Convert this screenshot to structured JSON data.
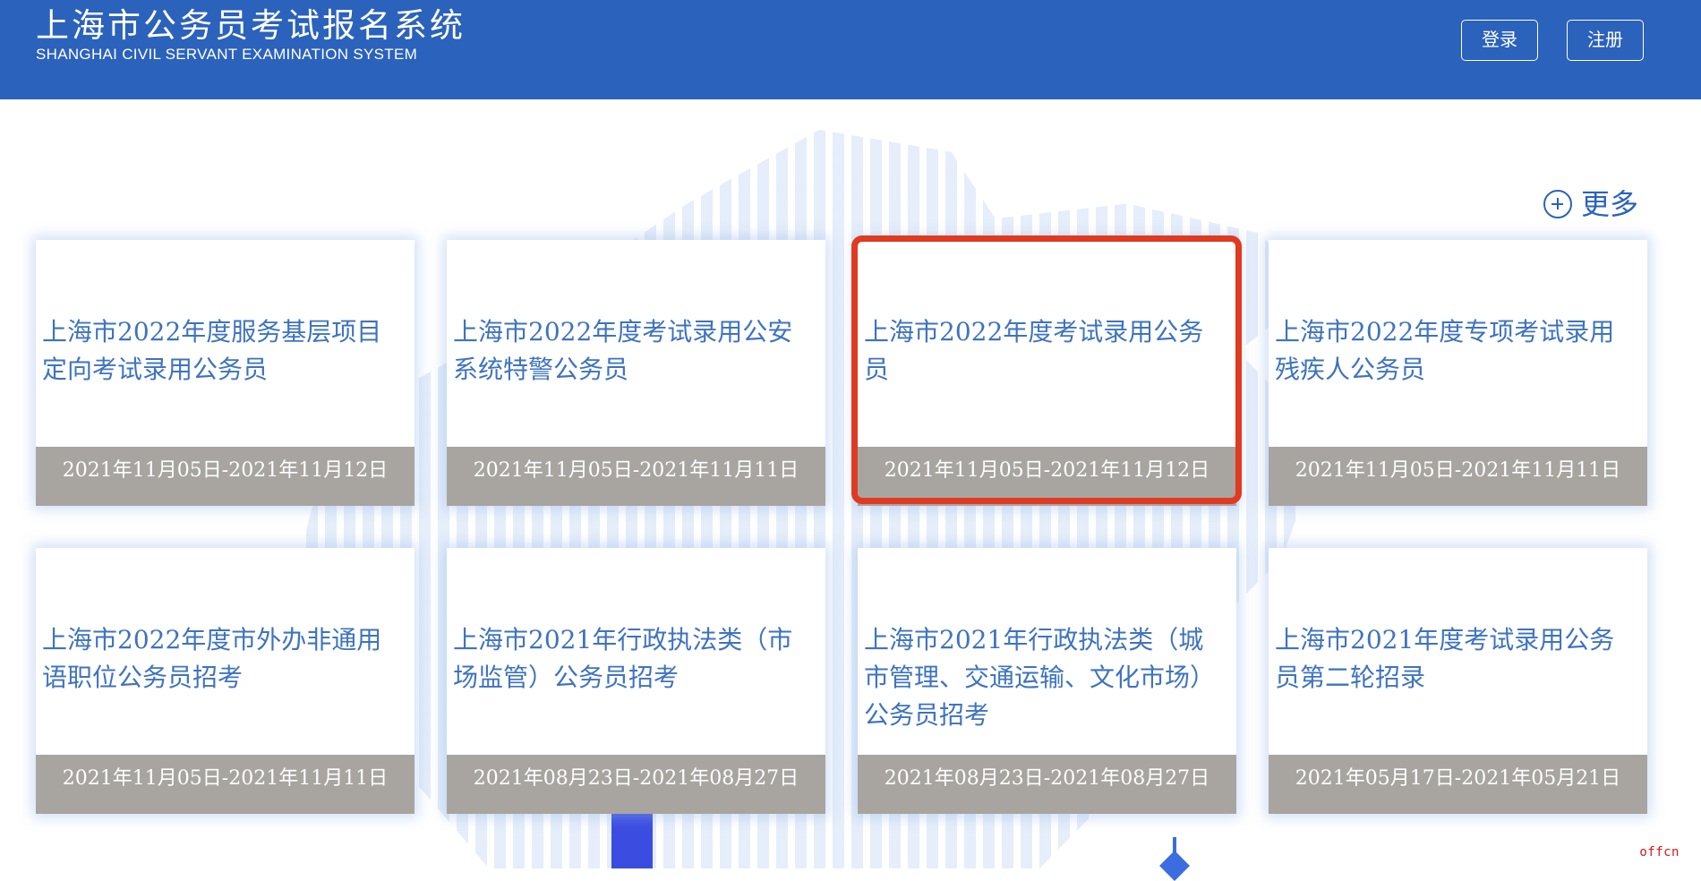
{
  "header": {
    "title": "上海市公务员考试报名系统",
    "subtitle": "SHANGHAI CIVIL SERVANT EXAMINATION SYSTEM",
    "login_label": "登录",
    "register_label": "注册"
  },
  "more": {
    "label": "更多",
    "icon": "plus-circle-icon"
  },
  "cards": [
    {
      "title": "上海市2022年度服务基层项目定向考试录用公务员",
      "date": "2021年11月05日-2021年11月12日"
    },
    {
      "title": "上海市2022年度考试录用公安系统特警公务员",
      "date": "2021年11月05日-2021年11月11日"
    },
    {
      "title": "上海市2022年度考试录用公务员",
      "date": "2021年11月05日-2021年11月12日"
    },
    {
      "title": "上海市2022年度专项考试录用残疾人公务员",
      "date": "2021年11月05日-2021年11月11日"
    },
    {
      "title": "上海市2022年度市外办非通用语职位公务员招考",
      "date": "2021年11月05日-2021年11月11日"
    },
    {
      "title": "上海市2021年行政执法类（市场监管）公务员招考",
      "date": "2021年08月23日-2021年08月27日"
    },
    {
      "title": "上海市2021年行政执法类（城市管理、交通运输、文化市场）公务员招考",
      "date": "2021年08月23日-2021年08月27日"
    },
    {
      "title": "上海市2021年度考试录用公务员第二轮招录",
      "date": "2021年05月17日-2021年05月21日"
    }
  ],
  "watermark": "offcn",
  "colors": {
    "header_bg": "#2b62bb",
    "card_title": "#3e73bf",
    "date_bar": "#a8a5a1",
    "highlight": "#e03a22"
  }
}
